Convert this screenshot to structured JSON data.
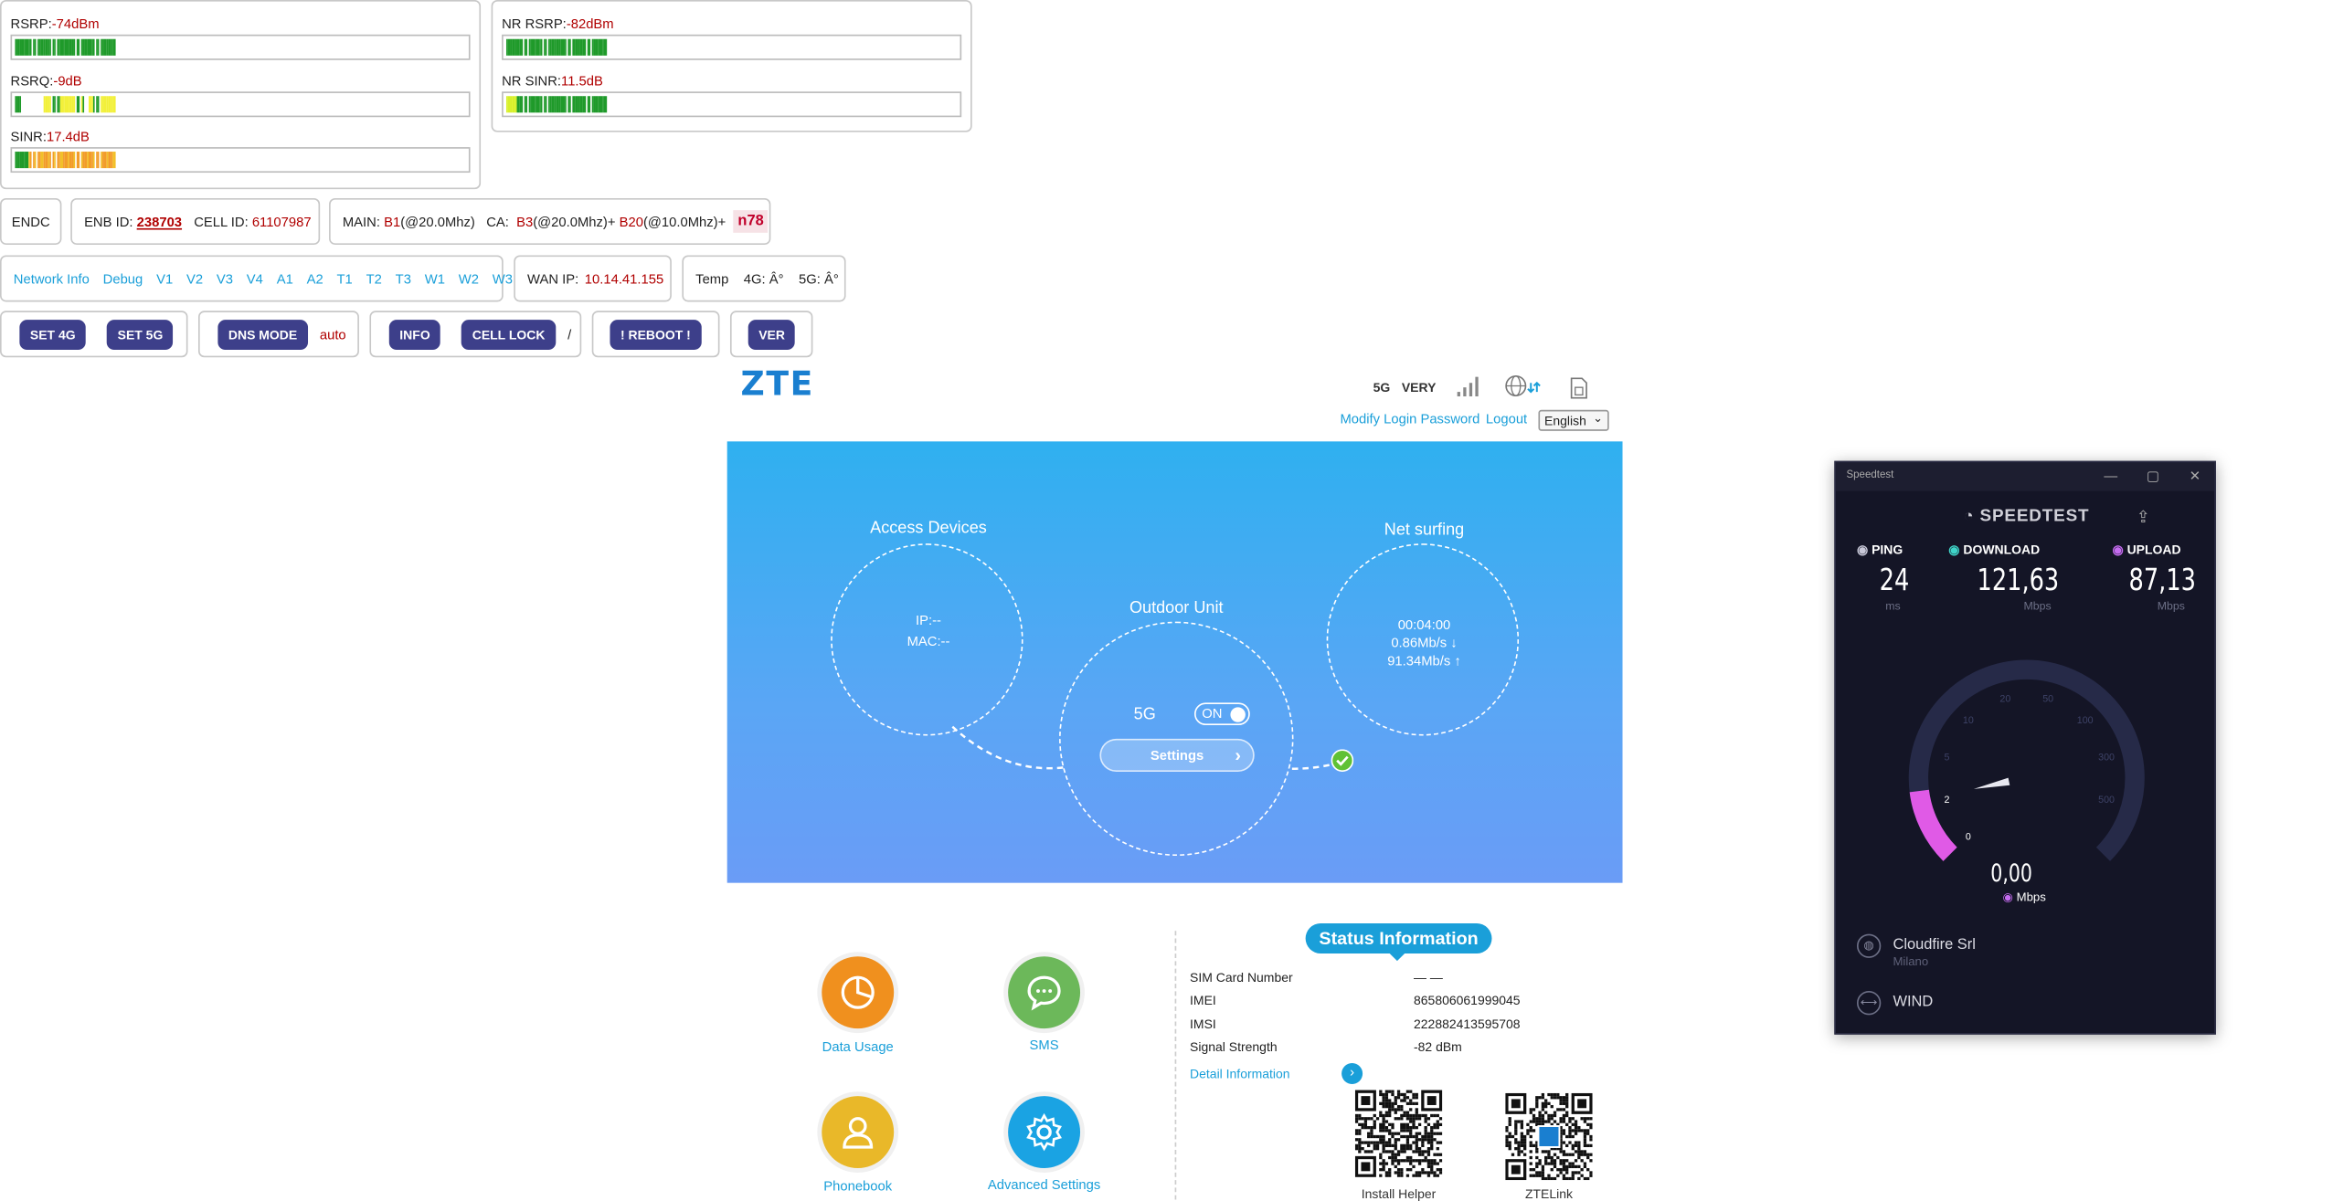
{
  "signal": {
    "lte": [
      {
        "label": "RSRP:",
        "value": "-74dBm"
      },
      {
        "label": "RSRQ:",
        "value": "-9dB"
      },
      {
        "label": "SINR:",
        "value": "17.4dB"
      }
    ],
    "nr": [
      {
        "label": "NR RSRP:",
        "value": "-82dBm"
      },
      {
        "label": "NR SINR:",
        "value": "11.5dB"
      }
    ]
  },
  "info_row": {
    "mode": "ENDC",
    "enb_label": "ENB ID:",
    "enb_value": "238703",
    "cell_label": "CELL ID:",
    "cell_value": "61107987",
    "main_label": "MAIN:",
    "main_band": "B1",
    "main_bw": "(@20.0Mhz)",
    "ca_label": "CA:",
    "ca_band1": "B3",
    "ca_bw1": "(@20.0Mhz)+",
    "ca_band2": "B20",
    "ca_bw2": "(@10.0Mhz)+",
    "nr_band": "n78"
  },
  "nav_links": [
    "Network Info",
    "Debug",
    "V1",
    "V2",
    "V3",
    "V4",
    "A1",
    "A2",
    "T1",
    "T2",
    "T3",
    "W1",
    "W2",
    "W3"
  ],
  "wan": {
    "label": "WAN IP:",
    "value": "10.14.41.155"
  },
  "temp": {
    "label": "Temp",
    "g4": "4G: Â°",
    "g5": "5G: Â°"
  },
  "buttons": {
    "set4g": "SET 4G",
    "set5g": "SET 5G",
    "dns_mode": "DNS MODE",
    "dns_value": "auto",
    "info": "INFO",
    "cell_lock": "CELL LOCK",
    "cell_lock_value": "/",
    "reboot": "! REBOOT !",
    "ver": "VER"
  },
  "zte": {
    "logo": "ZTE",
    "net_type": "5G",
    "signal_quality": "VERY",
    "modify_password": "Modify Login Password",
    "logout": "Logout",
    "language": "English"
  },
  "hero": {
    "access_devices": "Access Devices",
    "ip": "IP:--",
    "mac": "MAC:--",
    "outdoor_unit": "Outdoor Unit",
    "band": "5G",
    "toggle": "ON",
    "settings": "Settings",
    "net_surfing": "Net surfing",
    "duration": "00:04:00",
    "down_rate": "0.86Mb/s ↓",
    "up_rate": "91.34Mb/s ↑"
  },
  "shortcuts": [
    {
      "label": "Data Usage",
      "icon": "pie-chart-icon",
      "color": "#f0901e"
    },
    {
      "label": "SMS",
      "icon": "chat-icon",
      "color": "#6cb85a"
    },
    {
      "label": "Phonebook",
      "icon": "person-icon",
      "color": "#e9b829"
    },
    {
      "label": "Advanced Settings",
      "icon": "gear-icon",
      "color": "#1aa3e3"
    }
  ],
  "status": {
    "title": "Status Information",
    "rows": [
      {
        "key": "SIM Card Number",
        "value": "— —"
      },
      {
        "key": "IMEI",
        "value": "865806061999045"
      },
      {
        "key": "IMSI",
        "value": "222882413595708"
      },
      {
        "key": "Signal Strength",
        "value": "-82 dBm"
      }
    ],
    "detail": "Detail Information",
    "qr1": "Install Helper",
    "qr2": "ZTELink"
  },
  "speedtest": {
    "window_title": "Speedtest",
    "logo": "SPEEDTEST",
    "ping_label": "PING",
    "ping_value": "24",
    "ping_unit": "ms",
    "download_label": "DOWNLOAD",
    "download_value": "121,63",
    "download_unit": "Mbps",
    "upload_label": "UPLOAD",
    "upload_value": "87,13",
    "upload_unit": "Mbps",
    "gauge_ticks": [
      "0",
      "2",
      "5",
      "10",
      "20",
      "50",
      "100",
      "300",
      "500"
    ],
    "current_value": "0,00",
    "current_unit": "Mbps",
    "server_name": "Cloudfire Srl",
    "server_city": "Milano",
    "isp": "WIND",
    "colors": {
      "ping": "#c8c8d8",
      "download": "#3fd4c8",
      "upload": "#c56cf0",
      "accent": "#e05ae6"
    }
  }
}
